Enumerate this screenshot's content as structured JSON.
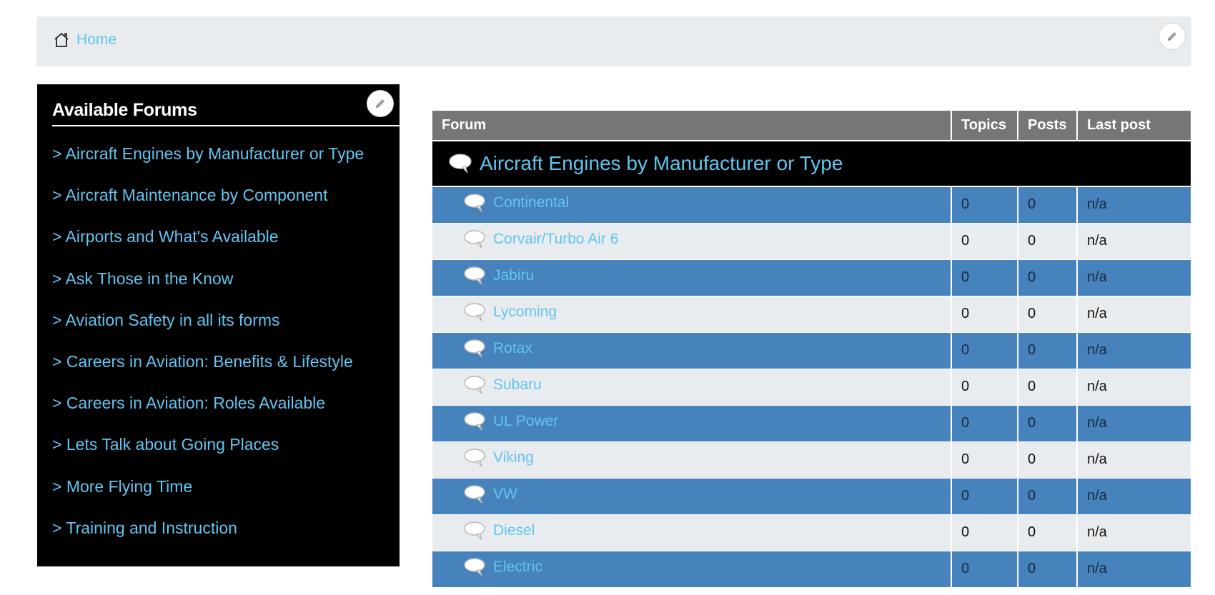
{
  "breadcrumb": {
    "home_label": "Home",
    "icon": "home-icon"
  },
  "sidebar": {
    "title": "Available Forums",
    "items": [
      "> Aircraft Engines by Manufacturer or Type",
      "> Aircraft Maintenance by Component",
      "> Airports and What's Available",
      "> Ask Those in the Know",
      "> Aviation Safety in all its forms",
      "> Careers in Aviation: Benefits & Lifestyle",
      "> Careers in Aviation: Roles Available",
      "> Lets Talk about Going Places",
      "> More Flying Time",
      "> Training and Instruction"
    ]
  },
  "table": {
    "headers": {
      "forum": "Forum",
      "topics": "Topics",
      "posts": "Posts",
      "last_post": "Last post"
    },
    "category": "Aircraft Engines by Manufacturer or Type",
    "rows": [
      {
        "name": "Continental",
        "topics": "0",
        "posts": "0",
        "last_post": "n/a"
      },
      {
        "name": "Corvair/Turbo Air 6",
        "topics": "0",
        "posts": "0",
        "last_post": "n/a"
      },
      {
        "name": "Jabiru",
        "topics": "0",
        "posts": "0",
        "last_post": "n/a"
      },
      {
        "name": "Lycoming",
        "topics": "0",
        "posts": "0",
        "last_post": "n/a"
      },
      {
        "name": "Rotax",
        "topics": "0",
        "posts": "0",
        "last_post": "n/a"
      },
      {
        "name": "Subaru",
        "topics": "0",
        "posts": "0",
        "last_post": "n/a"
      },
      {
        "name": "UL Power",
        "topics": "0",
        "posts": "0",
        "last_post": "n/a"
      },
      {
        "name": "Viking",
        "topics": "0",
        "posts": "0",
        "last_post": "n/a"
      },
      {
        "name": "VW",
        "topics": "0",
        "posts": "0",
        "last_post": "n/a"
      },
      {
        "name": "Diesel",
        "topics": "0",
        "posts": "0",
        "last_post": "n/a"
      },
      {
        "name": "Electric",
        "topics": "0",
        "posts": "0",
        "last_post": "n/a"
      }
    ]
  },
  "colors": {
    "link": "#62c4ef",
    "row_blue": "#4682bc",
    "row_gray": "#e9ecef",
    "header_gray": "#767676",
    "sidebar_bg": "#000000"
  }
}
